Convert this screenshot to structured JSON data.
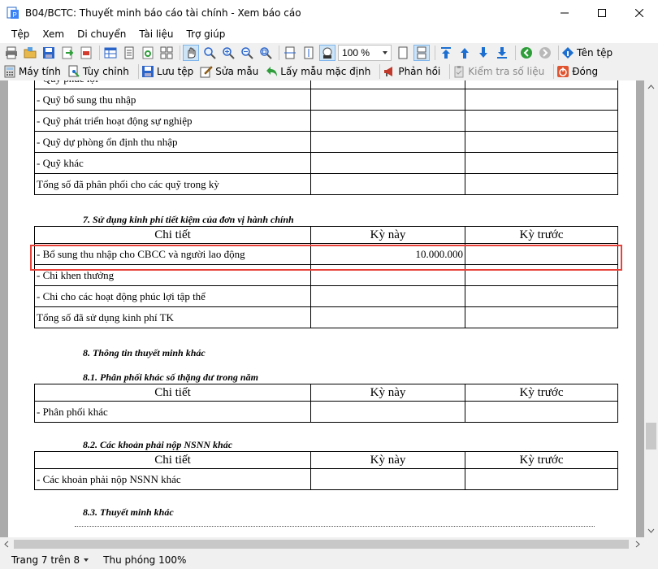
{
  "window": {
    "title": "B04/BCTC: Thuyết minh báo cáo tài chính - Xem báo cáo"
  },
  "menu": [
    "Tệp",
    "Xem",
    "Di chuyển",
    "Tài liệu",
    "Trợ giúp"
  ],
  "toolbar1": {
    "zoom_value": "100 %",
    "filename_label": "Tên tệp"
  },
  "toolbar2": {
    "calculator": "Máy tính",
    "customize": "Tùy chỉnh",
    "save_template": "Lưu tệp",
    "edit_template": "Sửa mẫu",
    "default_template": "Lấy mẫu mặc định",
    "feedback": "Phản hồi",
    "check_data": "Kiểm tra số liệu",
    "close": "Đóng"
  },
  "report": {
    "top_table": {
      "rows": [
        "- Quỹ phúc lợi",
        "- Quỹ bổ sung thu nhập",
        "- Quỹ phát triển hoạt động sự nghiệp",
        "- Quỹ dự phòng ổn định thu nhập",
        "- Quỹ khác",
        "Tổng số đã phân phối cho các quỹ trong kỳ"
      ]
    },
    "section7": {
      "title": "7. Sử dụng kinh phí tiết kiệm của đơn vị hành chính",
      "headers": [
        "Chi tiết",
        "Kỳ này",
        "Kỳ trước"
      ],
      "rows": [
        {
          "label": "- Bổ sung thu nhập cho CBCC và người lao động",
          "current": "10.000.000",
          "previous": ""
        },
        {
          "label": "- Chi khen thưởng",
          "current": "",
          "previous": ""
        },
        {
          "label": "- Chi cho các hoạt động phúc lợi tập thể",
          "current": "",
          "previous": ""
        },
        {
          "label": "Tổng số đã sử dụng kinh phí TK",
          "current": "",
          "previous": ""
        }
      ]
    },
    "section8": {
      "title": "8. Thông tin thuyết minh khác"
    },
    "section8_1": {
      "title": "8.1. Phân phối khác số thặng dư trong năm",
      "headers": [
        "Chi tiết",
        "Kỳ này",
        "Kỳ trước"
      ],
      "rows": [
        {
          "label": "- Phân phối khác"
        }
      ]
    },
    "section8_2": {
      "title": "8.2. Các khoản phải nộp NSNN khác",
      "headers": [
        "Chi tiết",
        "Kỳ này",
        "Kỳ trước"
      ],
      "rows": [
        {
          "label": "- Các khoản phải nộp NSNN khác"
        }
      ]
    },
    "section8_3": {
      "title": "8.3. Thuyết minh khác"
    }
  },
  "status": {
    "page": "Trang 7 trên 8",
    "zoom": "Thu phóng 100%"
  },
  "colors": {
    "highlight": "#e8413a",
    "accent_blue": "#1c6fd1",
    "accent_green": "#2e9d3a"
  }
}
